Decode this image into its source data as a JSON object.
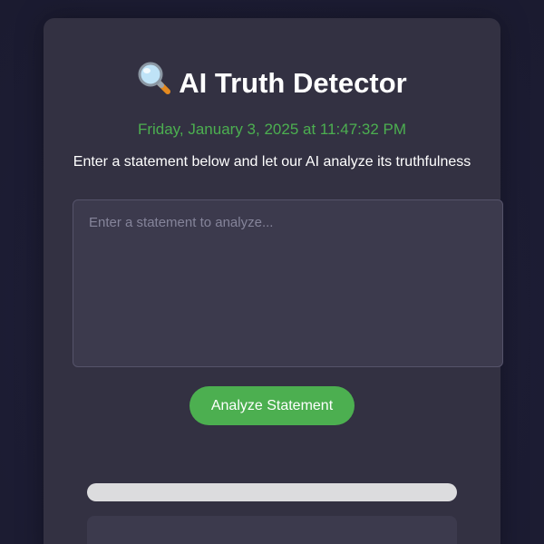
{
  "app": {
    "title": "AI Truth Detector",
    "title_icon": "magnifying-glass-icon",
    "datetime": "Friday, January 3, 2025 at 11:47:32 PM",
    "subtitle": "Enter a statement below and let our AI analyze its truthfulness"
  },
  "form": {
    "statement_placeholder": "Enter a statement to analyze...",
    "statement_value": "",
    "analyze_label": "Analyze Statement"
  },
  "result": {
    "truth_meter_percent": 0,
    "text": ""
  },
  "colors": {
    "accent": "#4caf50",
    "card_bg": "#333142",
    "page_bg": "#1d1d33",
    "input_bg": "#3c3a4d",
    "track": "#dcdcde"
  }
}
